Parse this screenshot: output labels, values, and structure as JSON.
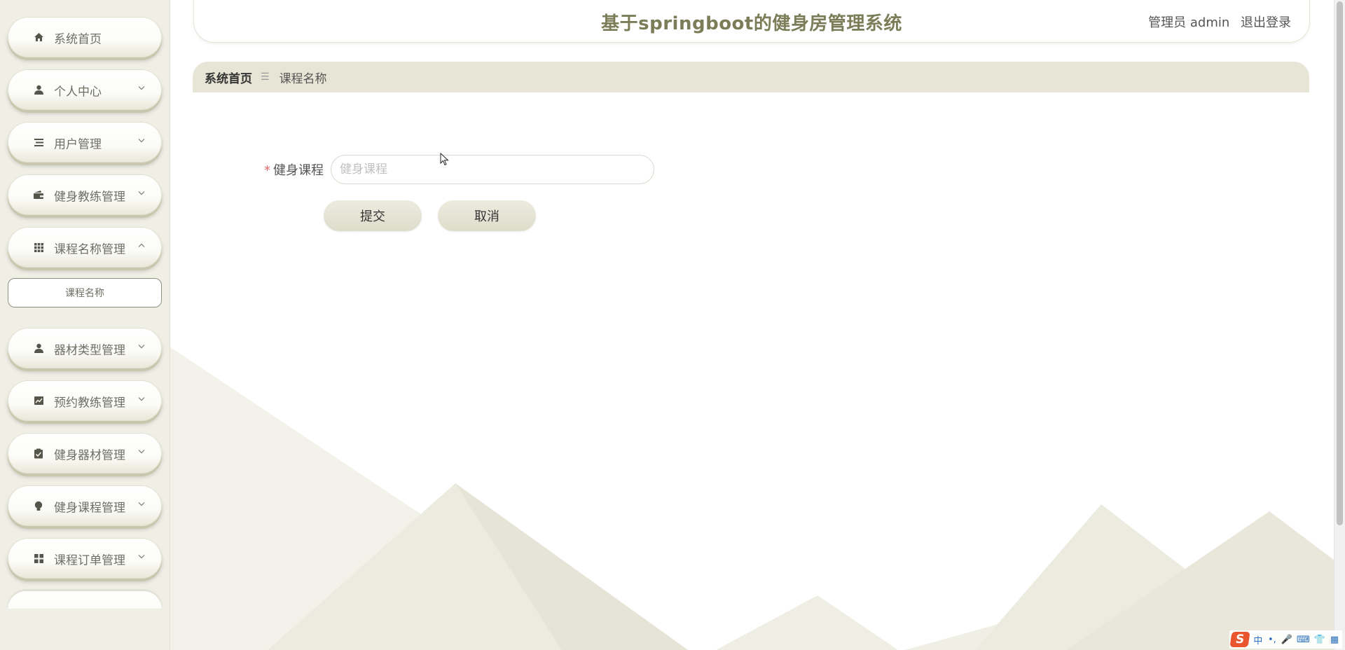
{
  "header": {
    "title": "基于springboot的健身房管理系统",
    "user_label": "管理员 admin",
    "logout_label": "退出登录"
  },
  "sidebar": {
    "items": [
      {
        "label": "系统首页",
        "icon": "home-icon"
      },
      {
        "label": "个人中心",
        "icon": "person-icon"
      },
      {
        "label": "用户管理",
        "icon": "list-icon"
      },
      {
        "label": "健身教练管理",
        "icon": "wallet-icon"
      },
      {
        "label": "课程名称管理",
        "icon": "grid-icon"
      },
      {
        "label": "器材类型管理",
        "icon": "person-icon"
      },
      {
        "label": "预约教练管理",
        "icon": "chart-icon"
      },
      {
        "label": "健身器材管理",
        "icon": "clipboard-icon"
      },
      {
        "label": "健身课程管理",
        "icon": "bulb-icon"
      },
      {
        "label": "课程订单管理",
        "icon": "apps-icon"
      }
    ],
    "submenu": {
      "label": "课程名称"
    }
  },
  "breadcrumb": {
    "home": "系统首页",
    "separator": "☰",
    "current": "课程名称"
  },
  "form": {
    "field_label": "健身课程",
    "required_mark": "*",
    "field_placeholder": "健身课程",
    "field_value": "",
    "submit_label": "提交",
    "cancel_label": "取消"
  },
  "tray": {
    "ime_logo": "S",
    "items": [
      "中",
      "•,",
      "🎤",
      "⌨",
      "👕",
      "▦"
    ]
  },
  "colors": {
    "sidebar_bg": "#efefe6",
    "accent": "#7b7d58",
    "breadcrumb_bg": "#e6e5d6",
    "button_bg": "#e3e2d2",
    "required": "#e96a6a"
  }
}
